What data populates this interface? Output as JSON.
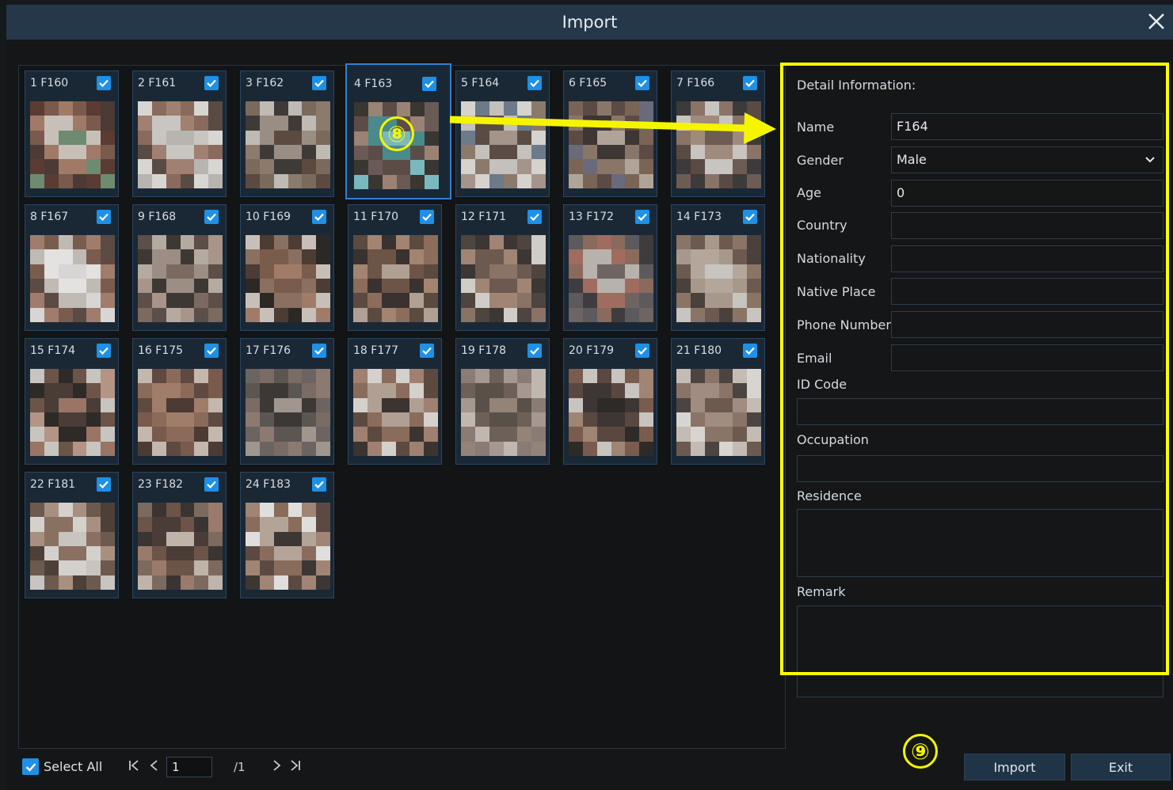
{
  "window": {
    "title": "Import"
  },
  "thumbnails": [
    {
      "label": "1 F160",
      "selected": false,
      "palette": [
        "#5a3c34",
        "#7a5a4c",
        "#a07a66",
        "#4b3a36",
        "#c8c0b8",
        "#6e8a70"
      ]
    },
    {
      "label": "2 F161",
      "selected": false,
      "palette": [
        "#b8b4b0",
        "#d8d6d2",
        "#8a6a5c",
        "#a08070",
        "#5a4a44",
        "#c9c5c0"
      ]
    },
    {
      "label": "3 F162",
      "selected": false,
      "palette": [
        "#9a8e84",
        "#5c4a40",
        "#7a6a5c",
        "#c0bab4",
        "#3e3a38",
        "#8c7a6c"
      ]
    },
    {
      "label": "4 F163",
      "selected": true,
      "palette": [
        "#6a5a56",
        "#4a8a8a",
        "#7ab8c0",
        "#3a3632",
        "#9a8274",
        "#5c4c48"
      ]
    },
    {
      "label": "5 F164",
      "selected": false,
      "palette": [
        "#c4c0bc",
        "#8a7a6c",
        "#5a4c44",
        "#a4948a",
        "#d6d2ce",
        "#6c7a8a"
      ]
    },
    {
      "label": "6 F165",
      "selected": false,
      "palette": [
        "#5c4a44",
        "#8a7668",
        "#6a6a7a",
        "#3c3634",
        "#b0a498",
        "#7a6456"
      ]
    },
    {
      "label": "7 F166",
      "selected": false,
      "palette": [
        "#3c3a3a",
        "#8a7468",
        "#c8c4c0",
        "#5a4a44",
        "#a08a7c",
        "#6c5c54"
      ]
    },
    {
      "label": "8 F167",
      "selected": false,
      "palette": [
        "#d8d6d4",
        "#a07c6c",
        "#7a5c4e",
        "#c0bab4",
        "#5c4a44",
        "#e4e2e0"
      ]
    },
    {
      "label": "9 F168",
      "selected": false,
      "palette": [
        "#9c8e84",
        "#7c6a60",
        "#5c4e48",
        "#b4aaa0",
        "#3e3834",
        "#a89488"
      ]
    },
    {
      "label": "10 F169",
      "selected": false,
      "palette": [
        "#2c2826",
        "#7a5c4c",
        "#a07c68",
        "#c8c0b8",
        "#4c3c34",
        "#8a7060"
      ]
    },
    {
      "label": "11 F170",
      "selected": false,
      "palette": [
        "#3a3230",
        "#8c6c5a",
        "#6c5446",
        "#b0a094",
        "#5a4a40",
        "#a28470"
      ]
    },
    {
      "label": "12 F171",
      "selected": false,
      "palette": [
        "#3c3634",
        "#a08474",
        "#d0ccc8",
        "#6c5a50",
        "#8a7264",
        "#4e4440"
      ]
    },
    {
      "label": "13 F172",
      "selected": false,
      "palette": [
        "#5c5a5c",
        "#8a6a5c",
        "#a06c60",
        "#3e3c3e",
        "#b8b2ac",
        "#6e6462"
      ]
    },
    {
      "label": "14 F173",
      "selected": false,
      "palette": [
        "#c8c4c0",
        "#8a7466",
        "#6c5a50",
        "#a8988c",
        "#4a403c",
        "#b4a69a"
      ]
    },
    {
      "label": "15 F174",
      "selected": false,
      "palette": [
        "#4a3c36",
        "#9a7464",
        "#c8c4c0",
        "#6c5448",
        "#2e2a28",
        "#b49484"
      ]
    },
    {
      "label": "16 F175",
      "selected": false,
      "palette": [
        "#7a5a4c",
        "#a07c6a",
        "#4c3a34",
        "#c4b8ae",
        "#5e4a40",
        "#8c6a5a"
      ]
    },
    {
      "label": "17 F176",
      "selected": false,
      "palette": [
        "#5c5652",
        "#8c7a70",
        "#3c3836",
        "#a0968e",
        "#6c6460",
        "#7a6c64"
      ]
    },
    {
      "label": "18 F177",
      "selected": false,
      "palette": [
        "#d4d0cc",
        "#8a6c5c",
        "#5c4a40",
        "#b0a094",
        "#3c3430",
        "#a08070"
      ]
    },
    {
      "label": "19 F178",
      "selected": false,
      "palette": [
        "#8a7c74",
        "#a69890",
        "#6c6058",
        "#c0b8b0",
        "#5a504a",
        "#948478"
      ]
    },
    {
      "label": "20 F179",
      "selected": false,
      "palette": [
        "#2e2a28",
        "#7a5c4e",
        "#c8c4c0",
        "#5a4840",
        "#a08474",
        "#3e3634"
      ]
    },
    {
      "label": "21 F180",
      "selected": false,
      "palette": [
        "#a08c80",
        "#6c5a50",
        "#c4bcb4",
        "#4c4440",
        "#8a7468",
        "#d8d4d0"
      ]
    },
    {
      "label": "22 F181",
      "selected": false,
      "palette": [
        "#4c4038",
        "#8a7060",
        "#c8c4c0",
        "#6c5a4e",
        "#a89080",
        "#d4d0cc"
      ]
    },
    {
      "label": "23 F182",
      "selected": false,
      "palette": [
        "#6c5448",
        "#9a7a6a",
        "#4a3c36",
        "#c0b4aa",
        "#7c6a5e",
        "#3a3432"
      ]
    },
    {
      "label": "24 F183",
      "selected": false,
      "palette": [
        "#e0dedc",
        "#8a6c5c",
        "#5c4a42",
        "#b4a498",
        "#3c3634",
        "#a08474"
      ]
    }
  ],
  "detail": {
    "title": "Detail Information:",
    "name_label": "Name",
    "name_value": "F164",
    "gender_label": "Gender",
    "gender_value": "Male",
    "age_label": "Age",
    "age_value": "0",
    "country_label": "Country",
    "country_value": "",
    "nationality_label": "Nationality",
    "nationality_value": "",
    "native_place_label": "Native Place",
    "native_place_value": "",
    "phone_label": "Phone Number",
    "phone_value": "",
    "email_label": "Email",
    "email_value": "",
    "id_code_label": "ID Code",
    "id_code_value": "",
    "occupation_label": "Occupation",
    "occupation_value": "",
    "residence_label": "Residence",
    "residence_value": "",
    "remark_label": "Remark",
    "remark_value": ""
  },
  "annotations": {
    "marker_8": "⑧",
    "marker_9": "⑨",
    "highlight_color": "#ffff00"
  },
  "footer": {
    "select_all_label": "Select All",
    "page_value": "1",
    "page_total": "/1",
    "import_label": "Import",
    "exit_label": "Exit"
  },
  "colors": {
    "accent": "#1e90e6",
    "titlebar": "#24384a",
    "button": "#1f3447"
  }
}
